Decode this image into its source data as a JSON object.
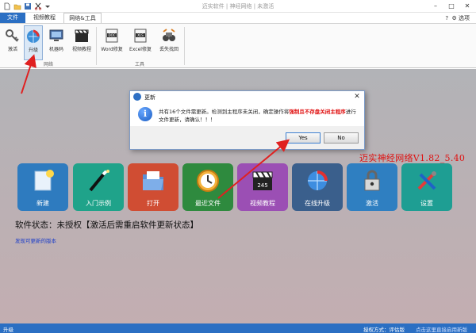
{
  "window": {
    "title": "迈实软件 | 神经网络 | 未激活",
    "help_label": "?",
    "options_label": "选项",
    "quick_access": [
      "new-file-icon",
      "open-folder-icon",
      "save-icon",
      "cut-icon",
      "dropdown-icon"
    ]
  },
  "tabs": [
    {
      "label": "文件",
      "selected": false
    },
    {
      "label": "视频教程",
      "selected": false
    },
    {
      "label": "网络&工具",
      "selected": true
    }
  ],
  "ribbon": {
    "groups": [
      {
        "label": "网络",
        "items": [
          {
            "label": "激活",
            "icon": "key-icon"
          },
          {
            "label": "升级",
            "icon": "upgrade-globe-icon",
            "selected": true
          },
          {
            "label": "机器码",
            "icon": "monitor-icon"
          },
          {
            "label": "视频教程",
            "icon": "clapperboard-icon"
          }
        ]
      },
      {
        "label": "工具",
        "items": [
          {
            "label": "Word修复",
            "icon": "doc-repair-icon"
          },
          {
            "label": "Excel修复",
            "icon": "xls-repair-icon"
          },
          {
            "label": "丢失找回",
            "icon": "recovery-icon"
          }
        ]
      }
    ]
  },
  "dialog": {
    "title": "更新",
    "message_part1": "共有16个文件需更新。检测到主程序未关闭，确定操作将",
    "message_red": "强制且不存盘关闭主程序",
    "message_part2": "进行文件更新，请确认！！！",
    "yes_label": "Yes",
    "no_label": "No"
  },
  "version": "迈实神经网络V1.82_5.40",
  "tiles": [
    {
      "label": "新建",
      "icon": "new-document-icon",
      "color": "#2e7bbf"
    },
    {
      "label": "入门示例",
      "icon": "magic-wand-icon",
      "color": "#1fa38a"
    },
    {
      "label": "打开",
      "icon": "open-folder-icon",
      "color": "#d04d33"
    },
    {
      "label": "最近文件",
      "icon": "clock-icon",
      "color": "#2e8a3e"
    },
    {
      "label": "视频教程",
      "icon": "clapperboard-icon",
      "color": "#9b4fb4"
    },
    {
      "label": "在线升级",
      "icon": "upgrade-globe-icon",
      "color": "#3a5f8c"
    },
    {
      "label": "激活",
      "icon": "lock-key-icon",
      "color": "#2f7fc1"
    },
    {
      "label": "设置",
      "icon": "tools-icon",
      "color": "#1e9e93"
    }
  ],
  "status_text": "软件状态：未授权【激活后需重启软件更新状态】",
  "update_link": "发现可更新的版本",
  "statusbar": {
    "left": "升级",
    "auth": "授权方式：评估版",
    "link": "点击这里直接启用新版"
  },
  "colors": {
    "accent": "#2b6fc3",
    "version_red": "#e01010",
    "arrow_red": "#e02020"
  }
}
